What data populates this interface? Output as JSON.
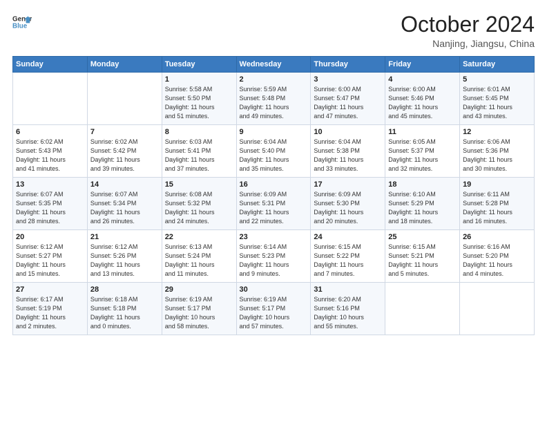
{
  "logo": {
    "line1": "General",
    "line2": "Blue"
  },
  "title": "October 2024",
  "subtitle": "Nanjing, Jiangsu, China",
  "days_of_week": [
    "Sunday",
    "Monday",
    "Tuesday",
    "Wednesday",
    "Thursday",
    "Friday",
    "Saturday"
  ],
  "weeks": [
    [
      {
        "day": "",
        "info": ""
      },
      {
        "day": "",
        "info": ""
      },
      {
        "day": "1",
        "info": "Sunrise: 5:58 AM\nSunset: 5:50 PM\nDaylight: 11 hours\nand 51 minutes."
      },
      {
        "day": "2",
        "info": "Sunrise: 5:59 AM\nSunset: 5:48 PM\nDaylight: 11 hours\nand 49 minutes."
      },
      {
        "day": "3",
        "info": "Sunrise: 6:00 AM\nSunset: 5:47 PM\nDaylight: 11 hours\nand 47 minutes."
      },
      {
        "day": "4",
        "info": "Sunrise: 6:00 AM\nSunset: 5:46 PM\nDaylight: 11 hours\nand 45 minutes."
      },
      {
        "day": "5",
        "info": "Sunrise: 6:01 AM\nSunset: 5:45 PM\nDaylight: 11 hours\nand 43 minutes."
      }
    ],
    [
      {
        "day": "6",
        "info": "Sunrise: 6:02 AM\nSunset: 5:43 PM\nDaylight: 11 hours\nand 41 minutes."
      },
      {
        "day": "7",
        "info": "Sunrise: 6:02 AM\nSunset: 5:42 PM\nDaylight: 11 hours\nand 39 minutes."
      },
      {
        "day": "8",
        "info": "Sunrise: 6:03 AM\nSunset: 5:41 PM\nDaylight: 11 hours\nand 37 minutes."
      },
      {
        "day": "9",
        "info": "Sunrise: 6:04 AM\nSunset: 5:40 PM\nDaylight: 11 hours\nand 35 minutes."
      },
      {
        "day": "10",
        "info": "Sunrise: 6:04 AM\nSunset: 5:38 PM\nDaylight: 11 hours\nand 33 minutes."
      },
      {
        "day": "11",
        "info": "Sunrise: 6:05 AM\nSunset: 5:37 PM\nDaylight: 11 hours\nand 32 minutes."
      },
      {
        "day": "12",
        "info": "Sunrise: 6:06 AM\nSunset: 5:36 PM\nDaylight: 11 hours\nand 30 minutes."
      }
    ],
    [
      {
        "day": "13",
        "info": "Sunrise: 6:07 AM\nSunset: 5:35 PM\nDaylight: 11 hours\nand 28 minutes."
      },
      {
        "day": "14",
        "info": "Sunrise: 6:07 AM\nSunset: 5:34 PM\nDaylight: 11 hours\nand 26 minutes."
      },
      {
        "day": "15",
        "info": "Sunrise: 6:08 AM\nSunset: 5:32 PM\nDaylight: 11 hours\nand 24 minutes."
      },
      {
        "day": "16",
        "info": "Sunrise: 6:09 AM\nSunset: 5:31 PM\nDaylight: 11 hours\nand 22 minutes."
      },
      {
        "day": "17",
        "info": "Sunrise: 6:09 AM\nSunset: 5:30 PM\nDaylight: 11 hours\nand 20 minutes."
      },
      {
        "day": "18",
        "info": "Sunrise: 6:10 AM\nSunset: 5:29 PM\nDaylight: 11 hours\nand 18 minutes."
      },
      {
        "day": "19",
        "info": "Sunrise: 6:11 AM\nSunset: 5:28 PM\nDaylight: 11 hours\nand 16 minutes."
      }
    ],
    [
      {
        "day": "20",
        "info": "Sunrise: 6:12 AM\nSunset: 5:27 PM\nDaylight: 11 hours\nand 15 minutes."
      },
      {
        "day": "21",
        "info": "Sunrise: 6:12 AM\nSunset: 5:26 PM\nDaylight: 11 hours\nand 13 minutes."
      },
      {
        "day": "22",
        "info": "Sunrise: 6:13 AM\nSunset: 5:24 PM\nDaylight: 11 hours\nand 11 minutes."
      },
      {
        "day": "23",
        "info": "Sunrise: 6:14 AM\nSunset: 5:23 PM\nDaylight: 11 hours\nand 9 minutes."
      },
      {
        "day": "24",
        "info": "Sunrise: 6:15 AM\nSunset: 5:22 PM\nDaylight: 11 hours\nand 7 minutes."
      },
      {
        "day": "25",
        "info": "Sunrise: 6:15 AM\nSunset: 5:21 PM\nDaylight: 11 hours\nand 5 minutes."
      },
      {
        "day": "26",
        "info": "Sunrise: 6:16 AM\nSunset: 5:20 PM\nDaylight: 11 hours\nand 4 minutes."
      }
    ],
    [
      {
        "day": "27",
        "info": "Sunrise: 6:17 AM\nSunset: 5:19 PM\nDaylight: 11 hours\nand 2 minutes."
      },
      {
        "day": "28",
        "info": "Sunrise: 6:18 AM\nSunset: 5:18 PM\nDaylight: 11 hours\nand 0 minutes."
      },
      {
        "day": "29",
        "info": "Sunrise: 6:19 AM\nSunset: 5:17 PM\nDaylight: 10 hours\nand 58 minutes."
      },
      {
        "day": "30",
        "info": "Sunrise: 6:19 AM\nSunset: 5:17 PM\nDaylight: 10 hours\nand 57 minutes."
      },
      {
        "day": "31",
        "info": "Sunrise: 6:20 AM\nSunset: 5:16 PM\nDaylight: 10 hours\nand 55 minutes."
      },
      {
        "day": "",
        "info": ""
      },
      {
        "day": "",
        "info": ""
      }
    ]
  ]
}
